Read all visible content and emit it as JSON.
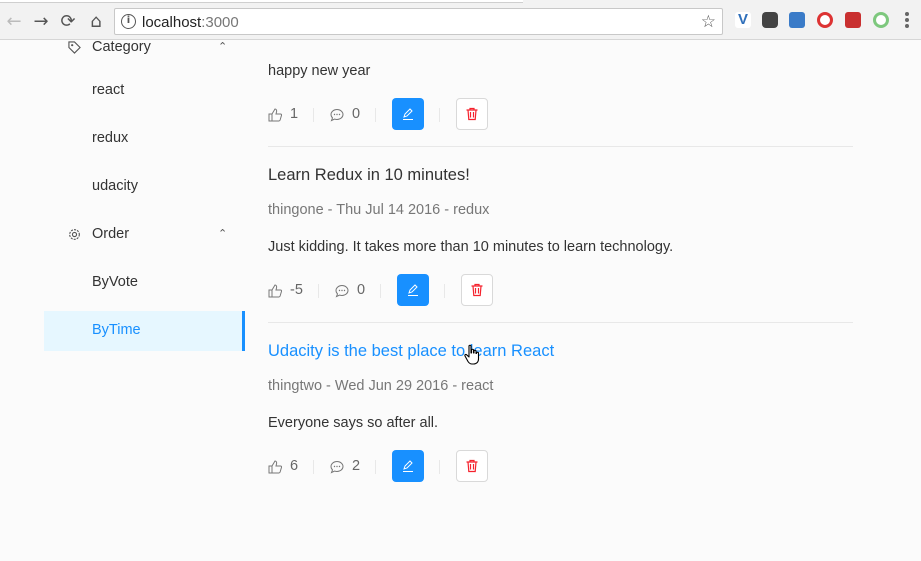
{
  "browser": {
    "url_host": "localhost",
    "url_port": ":3000",
    "back_glyph": "←",
    "forward_glyph": "→",
    "reload_glyph": "⟳",
    "home_glyph": "⌂",
    "star_glyph": "☆",
    "info_glyph": "i",
    "extension_v_label": "V"
  },
  "sidebar": {
    "category": {
      "label": "Category",
      "caret": "⌃"
    },
    "categories": [
      {
        "label": "react"
      },
      {
        "label": "redux"
      },
      {
        "label": "udacity"
      }
    ],
    "order": {
      "label": "Order",
      "caret": "⌃"
    },
    "orders": [
      {
        "label": "ByVote"
      },
      {
        "label": "ByTime"
      }
    ],
    "selected": "ByTime",
    "accent_color": "#1890ff",
    "selected_bg": "#e6f7ff"
  },
  "posts": [
    {
      "body": "happy new year",
      "votes": "1",
      "comments": "0"
    },
    {
      "title": "Learn Redux in 10 minutes!",
      "meta": "thingone - Thu Jul 14 2016 - redux",
      "body": "Just kidding. It takes more than 10 minutes to learn technology.",
      "votes": "-5",
      "comments": "0"
    },
    {
      "title": "Udacity is the best place to learn React",
      "meta": "thingtwo - Wed Jun 29 2016 - react",
      "body": "Everyone says so after all.",
      "votes": "6",
      "comments": "2"
    }
  ],
  "colors": {
    "primary": "#1890ff",
    "danger": "#f5222d"
  }
}
